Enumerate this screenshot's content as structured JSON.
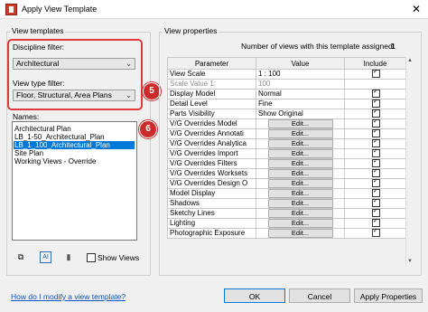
{
  "window": {
    "title": "Apply View Template",
    "close_glyph": "✕"
  },
  "view_templates": {
    "legend": "View templates",
    "discipline_filter_label": "Discipline filter:",
    "discipline_filter_value": "Architectural",
    "view_type_filter_label": "View type filter:",
    "view_type_filter_value": "Floor, Structural, Area Plans",
    "names_label": "Names:",
    "names": [
      "Architectural Plan",
      "LB_1-50_Architectural_Plan",
      "LB_1_100_Architectural_Plan",
      "Site Plan",
      "Working Views - Override"
    ],
    "selected_index": 2,
    "show_views_label": "Show Views",
    "duplicate_icon_glyph": "⧉",
    "rename_icon_glyph": "AI",
    "delete_icon_glyph": "▮"
  },
  "callouts": {
    "filter_badge": "5",
    "selection_badge": "6"
  },
  "view_properties": {
    "legend": "View properties",
    "assigned_count_label": "Number of views with this template assigned:",
    "assigned_count": "1",
    "columns": {
      "parameter": "Parameter",
      "value": "Value",
      "include": "Include"
    },
    "rows": [
      {
        "parameter": "View Scale",
        "value": "1 : 100",
        "include": true
      },
      {
        "parameter": "Scale Value  1:",
        "value": "100",
        "include": null
      },
      {
        "parameter": "Display Model",
        "value": "Normal",
        "include": true
      },
      {
        "parameter": "Detail Level",
        "value": "Fine",
        "include": true
      },
      {
        "parameter": "Parts Visibility",
        "value": "Show Original",
        "include": true
      },
      {
        "parameter": "V/G Overrides Model",
        "value": "Edit...",
        "include": true
      },
      {
        "parameter": "V/G Overrides Annotati",
        "value": "Edit...",
        "include": true
      },
      {
        "parameter": "V/G Overrides Analytica",
        "value": "Edit...",
        "include": true
      },
      {
        "parameter": "V/G Overrides Import",
        "value": "Edit...",
        "include": true
      },
      {
        "parameter": "V/G Overrides Filters",
        "value": "Edit...",
        "include": true
      },
      {
        "parameter": "V/G Overrides Worksets",
        "value": "Edit...",
        "include": true
      },
      {
        "parameter": "V/G Overrides Design O",
        "value": "Edit...",
        "include": true
      },
      {
        "parameter": "Model Display",
        "value": "Edit...",
        "include": true
      },
      {
        "parameter": "Shadows",
        "value": "Edit...",
        "include": true
      },
      {
        "parameter": "Sketchy Lines",
        "value": "Edit...",
        "include": true
      },
      {
        "parameter": "Lighting",
        "value": "Edit...",
        "include": true
      },
      {
        "parameter": "Photographic Exposure",
        "value": "Edit...",
        "include": true
      }
    ]
  },
  "footer": {
    "help_link": "How do I modify a view template?",
    "ok": "OK",
    "cancel": "Cancel",
    "apply_properties": "Apply Properties"
  },
  "colors": {
    "selection": "#0078d7",
    "callout": "#cc2b2b",
    "link": "#0a55c4"
  }
}
